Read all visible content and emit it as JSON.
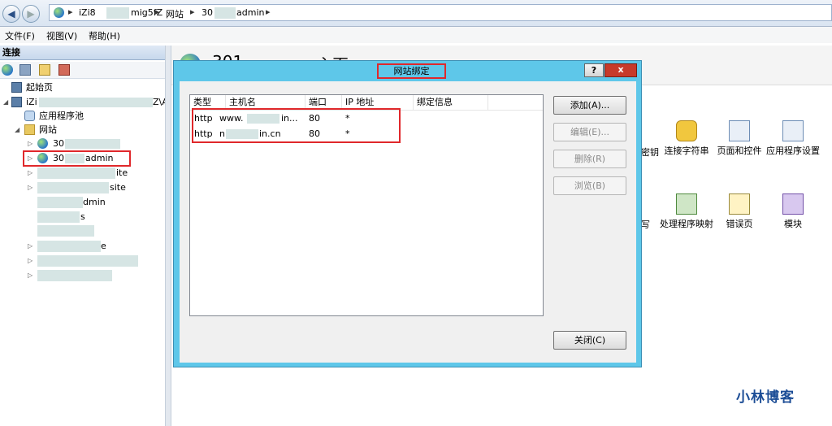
{
  "address": {
    "crumbs": [
      "iZi8",
      "mig5fZ",
      "网站",
      "30",
      "admin"
    ],
    "separator": "▸"
  },
  "menu": [
    "文件(F)",
    "视图(V)",
    "帮助(H)"
  ],
  "left": {
    "title": "连接",
    "tree": {
      "start_page": "起始页",
      "server": "iZi",
      "server_suffix": "Z\\A",
      "app_pools": "应用程序池",
      "sites": "网站",
      "site1_prefix": "30",
      "site2_prefix": "30",
      "site2_suffix": "admin",
      "partial_items": [
        "ite",
        "site",
        "dmin",
        "s",
        "e"
      ]
    }
  },
  "right": {
    "heading_fragment": "301",
    "heading_tail": "主页",
    "features": [
      {
        "name": "connection-strings",
        "label": "连接字符串"
      },
      {
        "name": "pages-controls",
        "label": "页面和控件"
      },
      {
        "name": "app-settings",
        "label": "应用程序设置"
      },
      {
        "name": "handler-mappings",
        "label": "处理程序映射"
      },
      {
        "name": "error-pages",
        "label": "错误页"
      },
      {
        "name": "modules",
        "label": "模块"
      }
    ],
    "partial_labels": [
      "密钥",
      "写"
    ]
  },
  "dialog": {
    "title": "网站绑定",
    "help_label": "?",
    "close_label": "x",
    "columns": [
      "类型",
      "主机名",
      "端口",
      "IP 地址",
      "绑定信息"
    ],
    "rows": [
      {
        "type": "http",
        "host": "www.",
        "host_tail": "in...",
        "port": "80",
        "ip": "*",
        "info": ""
      },
      {
        "type": "http",
        "host": "n",
        "host_tail": "in.cn",
        "port": "80",
        "ip": "*",
        "info": ""
      }
    ],
    "buttons": {
      "add": "添加(A)...",
      "edit": "编辑(E)...",
      "remove": "删除(R)",
      "browse": "浏览(B)",
      "close": "关闭(C)"
    }
  },
  "watermark": "小林博客",
  "colors": {
    "dialog_frame": "#5ec7e9",
    "highlight": "#e0282b",
    "watermark": "#1c4d96"
  }
}
